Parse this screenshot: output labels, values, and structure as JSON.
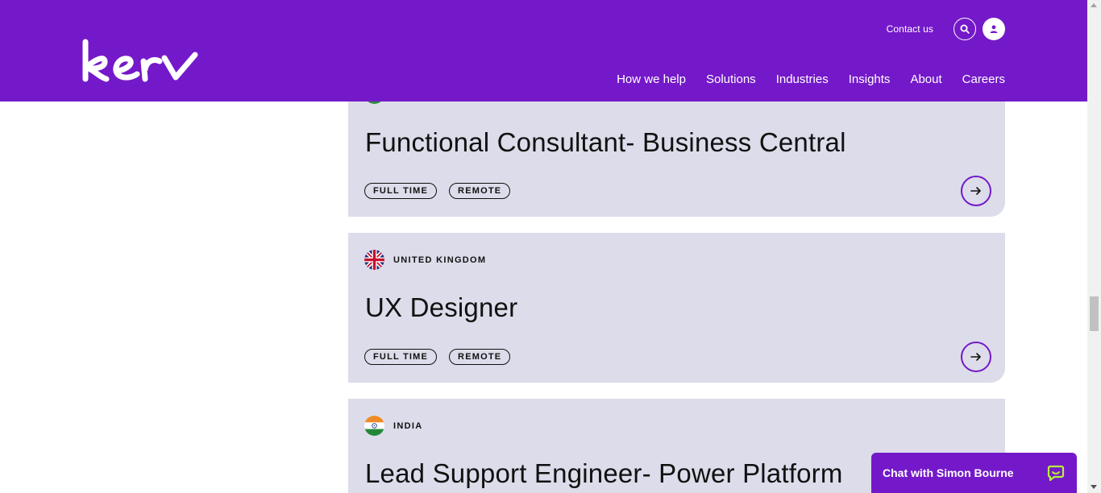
{
  "header": {
    "logo_text": "kerv",
    "contact_label": "Contact us",
    "nav": [
      "How we help",
      "Solutions",
      "Industries",
      "Insights",
      "About",
      "Careers"
    ]
  },
  "jobs": [
    {
      "country": "",
      "title": "Functional Consultant- Business Central",
      "tags": [
        "FULL TIME",
        "REMOTE"
      ]
    },
    {
      "country": "UNITED KINGDOM",
      "title": "UX Designer",
      "tags": [
        "FULL TIME",
        "REMOTE"
      ]
    },
    {
      "country": "INDIA",
      "title": "Lead Support Engineer- Power Platform",
      "tags": []
    }
  ],
  "chat": {
    "label": "Chat with Simon Bourne"
  },
  "colors": {
    "brand_purple": "#7419c9",
    "card_bg": "#dcdcea",
    "text": "#111111"
  }
}
